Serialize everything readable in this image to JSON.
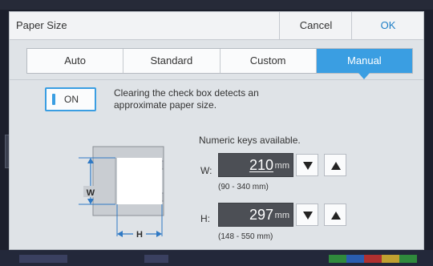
{
  "dialog": {
    "title": "Paper Size",
    "cancel_label": "Cancel",
    "ok_label": "OK"
  },
  "tabs": [
    {
      "label": "Auto"
    },
    {
      "label": "Standard"
    },
    {
      "label": "Custom"
    },
    {
      "label": "Manual",
      "active": true
    }
  ],
  "toggle": {
    "label": "ON",
    "state": "on"
  },
  "description": "Clearing the check box detects an approximate paper size.",
  "numeric_note": "Numeric keys available.",
  "width_field": {
    "label": "W:",
    "value": "210",
    "unit": "mm",
    "range": "(90 - 340 mm)"
  },
  "height_field": {
    "label": "H:",
    "value": "297",
    "unit": "mm",
    "range": "(148 - 550 mm)"
  },
  "illustration": {
    "w_label": "W",
    "h_label": "H"
  },
  "icons": {
    "decrement": "triangle-down-icon",
    "increment": "triangle-up-icon"
  },
  "colors": {
    "accent": "#3a9ee2",
    "field_bg": "#4c4f55",
    "ok_text": "#1f7fc6",
    "guide_blue": "#2f79c4"
  }
}
